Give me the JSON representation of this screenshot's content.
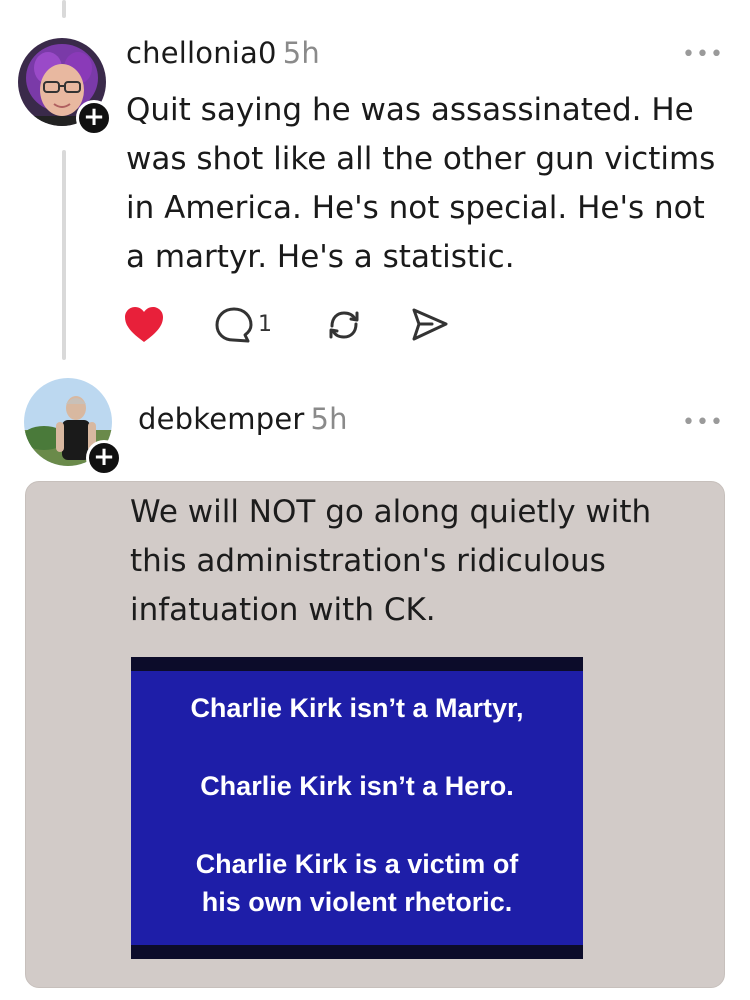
{
  "posts": [
    {
      "username": "chellonia0",
      "time": "5h",
      "more_label": "•••",
      "follow_label": "+",
      "text": "Quit saying he was assassinated. He was shot like all the other gun victims in America. He's not special. He's not a martyr. He's a statistic.",
      "liked": true,
      "reply_count": "1",
      "avatar_icon": "avatar-purple-hair-glasses"
    },
    {
      "username": "debkemper",
      "time": "5h",
      "more_label": "•••",
      "follow_label": "+",
      "avatar_icon": "avatar-person-outdoors",
      "image": {
        "caption": "We will NOT go along quietly with this administration's ridiculous infatuation with CK.",
        "box_lines": [
          "Charlie Kirk isn’t a Martyr,",
          "Charlie Kirk isn’t a Hero.",
          "Charlie Kirk is a victim of",
          "his own violent rhetoric."
        ],
        "box_color": "#1e1ea8"
      }
    }
  ],
  "colors": {
    "heart": "#e8203a",
    "muted": "#8a8a8a",
    "thread_line": "#d9d9d9"
  }
}
